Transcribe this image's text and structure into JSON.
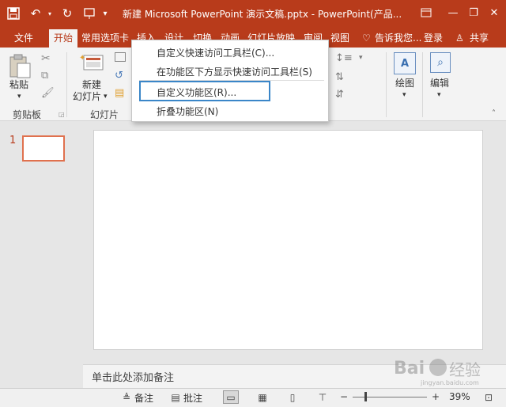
{
  "title_bar": {
    "title": "新建 Microsoft PowerPoint 演示文稿.pptx - PowerPoint(产品...",
    "save_icon": "save-icon",
    "undo_icon": "undo-icon",
    "redo_icon": "redo-icon",
    "present_icon": "present-from-start-icon"
  },
  "tabs": {
    "file": "文件",
    "items": [
      "开始",
      "常用选项卡",
      "插入",
      "设计",
      "切换",
      "动画",
      "幻灯片放映",
      "审阅",
      "视图"
    ],
    "active": "开始",
    "tell_me": "告诉我您...",
    "login": "登录",
    "share": "共享"
  },
  "ribbon": {
    "clipboard": {
      "paste": "粘贴",
      "group": "剪贴板"
    },
    "slides": {
      "new_slide_line1": "新建",
      "new_slide_line2": "幻灯片",
      "group": "幻灯片"
    },
    "drawing": {
      "label": "绘图"
    },
    "editing": {
      "label": "编辑"
    }
  },
  "menu": {
    "items": [
      "自定义快速访问工具栏(C)...",
      "在功能区下方显示快速访问工具栏(S)",
      "自定义功能区(R)...",
      "折叠功能区(N)"
    ],
    "highlighted_index": 2
  },
  "slide_pane": {
    "slide_number": "1"
  },
  "notes": {
    "placeholder": "单击此处添加备注"
  },
  "status_bar": {
    "notes": "备注",
    "comments": "批注",
    "zoom_out": "−",
    "zoom_in": "+",
    "zoom": "39%",
    "zoom_fraction": 0.39
  },
  "watermark": {
    "text": "Bai经验",
    "sub": "jingyan.baidu.com"
  },
  "colors": {
    "accent": "#b83b1b",
    "highlight_box": "#3a86c8",
    "thumb_border": "#e0714e"
  }
}
